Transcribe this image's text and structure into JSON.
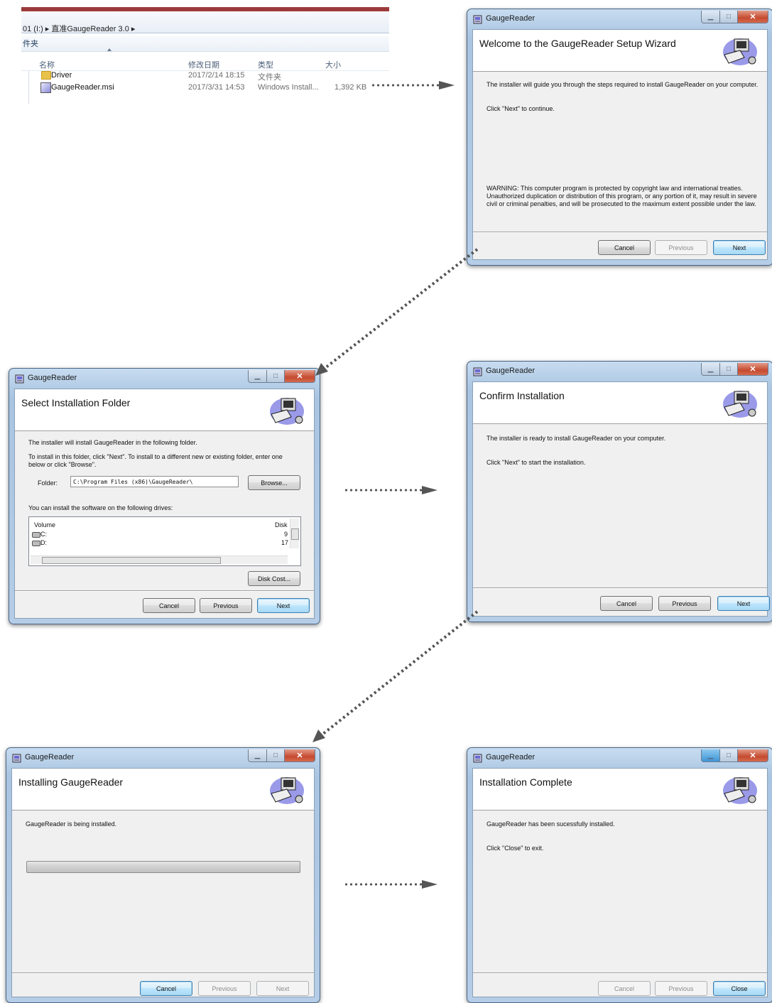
{
  "explorer": {
    "breadcrumb": "01 (I:)  ▸  直准GaugeReader 3.0  ▸",
    "toolbar_label": "件夹",
    "columns": [
      "名称",
      "修改日期",
      "类型",
      "大小"
    ],
    "rows": [
      {
        "name": "Driver",
        "date": "2017/2/14 18:15",
        "type": "文件夹",
        "size": ""
      },
      {
        "name": "GaugeReader.msi",
        "date": "2017/3/31 14:53",
        "type": "Windows Install...",
        "size": "1,392 KB"
      }
    ]
  },
  "app_title": "GaugeReader",
  "buttons": {
    "cancel": "Cancel",
    "previous": "Previous",
    "next": "Next",
    "close": "Close",
    "browse": "Browse...",
    "disk_cost": "Disk Cost..."
  },
  "welcome": {
    "title": "Welcome to the GaugeReader Setup Wizard",
    "line1": "The installer will guide you through the steps required to install GaugeReader on your computer.",
    "line2": "Click \"Next\" to continue.",
    "warning": "WARNING: This computer program is protected by copyright law and international treaties. Unauthorized duplication or distribution of this program, or any portion of it, may result in severe civil or criminal penalties, and will be prosecuted to the maximum extent possible under the law."
  },
  "select_folder": {
    "title": "Select Installation Folder",
    "line1": "The installer will install GaugeReader in the following folder.",
    "line2": "To install in this folder, click \"Next\". To install to a different new or existing folder, enter one below or click \"Browse\".",
    "folder_label": "Folder:",
    "folder_value": "C:\\Program Files (x86)\\GaugeReader\\",
    "drives_label": "You can install the software on the following drives:",
    "list_headers": {
      "volume": "Volume",
      "disk": "Disk"
    },
    "drives": [
      {
        "volume": "C:",
        "disk": "9"
      },
      {
        "volume": "D:",
        "disk": "17"
      }
    ]
  },
  "confirm": {
    "title": "Confirm Installation",
    "line1": "The installer is ready to install GaugeReader on your computer.",
    "line2": "Click \"Next\" to start the installation."
  },
  "installing": {
    "title": "Installing GaugeReader",
    "line1": "GaugeReader is being installed.",
    "progress": 0.0
  },
  "complete": {
    "title": "Installation Complete",
    "line1": "GaugeReader has been sucessfully installed.",
    "line2": "Click \"Close\" to exit."
  }
}
